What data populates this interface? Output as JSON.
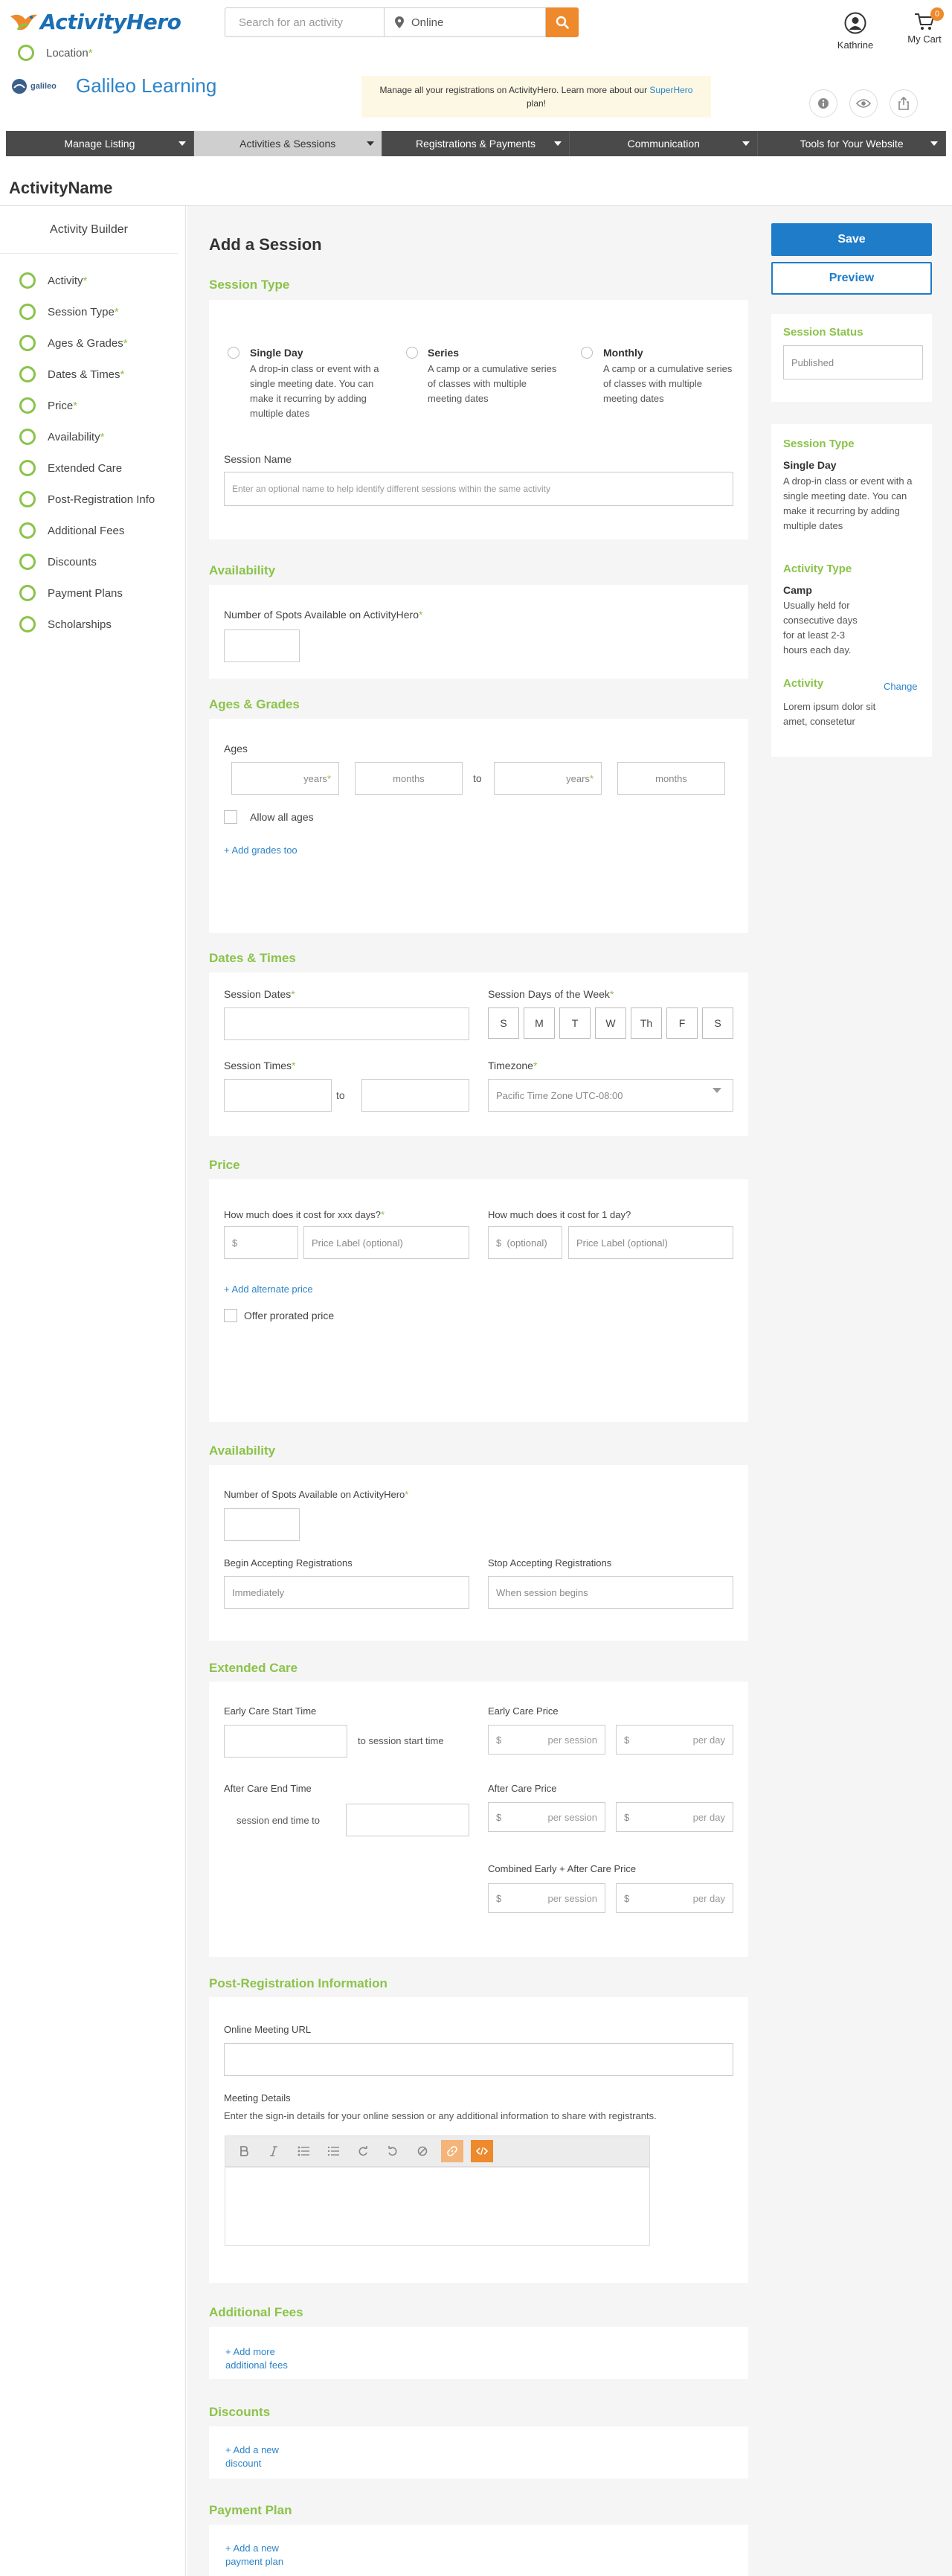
{
  "header": {
    "logo_text": "ActivityHero",
    "search_placeholder": "Search for an activity",
    "location_value": "Online",
    "user_name": "Kathrine",
    "cart_label": "My Cart",
    "cart_count": "0"
  },
  "location_step": {
    "label": "Location",
    "required": "*"
  },
  "organization": {
    "logo_text": "galileo",
    "name": "Galileo Learning"
  },
  "notice": {
    "text": "Manage all your registrations on ActivityHero. Learn more about our",
    "link": "SuperHero",
    "suffix": "plan!"
  },
  "nav": {
    "items": [
      {
        "label": "Manage Listing"
      },
      {
        "label": "Activities & Sessions"
      },
      {
        "label": "Registrations & Payments"
      },
      {
        "label": "Communication"
      },
      {
        "label": "Tools for Your Website"
      }
    ]
  },
  "page": {
    "title": "ActivityName"
  },
  "sidebar": {
    "title": "Activity Builder",
    "items": [
      {
        "label": "Activity",
        "required": "*"
      },
      {
        "label": "Session Type",
        "required": "*"
      },
      {
        "label": "Ages & Grades",
        "required": "*"
      },
      {
        "label": "Dates & Times",
        "required": "*"
      },
      {
        "label": "Price",
        "required": "*"
      },
      {
        "label": "Availability",
        "required": "*"
      },
      {
        "label": "Extended Care",
        "required": ""
      },
      {
        "label": "Post-Registration Info",
        "required": ""
      },
      {
        "label": "Additional Fees",
        "required": ""
      },
      {
        "label": "Discounts",
        "required": ""
      },
      {
        "label": "Payment Plans",
        "required": ""
      },
      {
        "label": "Scholarships",
        "required": ""
      }
    ]
  },
  "form": {
    "title": "Add a Session",
    "session_type": {
      "heading": "Session Type",
      "options": [
        {
          "title": "Single Day",
          "desc": "A drop-in class or event with a single meeting date. You can make it recurring by adding multiple dates"
        },
        {
          "title": "Series",
          "desc": "A camp or a cumulative series of classes with multiple meeting dates"
        },
        {
          "title": "Monthly",
          "desc": "A camp or a cumulative series of classes with multiple meeting dates"
        }
      ],
      "name_label": "Session Name",
      "name_placeholder": "Enter an optional name to help identify different sessions within the same activity"
    },
    "availability1": {
      "heading": "Availability",
      "spots_label": "Number of Spots Available on ActivityHero",
      "required": "*"
    },
    "ages": {
      "heading": "Ages & Grades",
      "label": "Ages",
      "years": "years",
      "months": "months",
      "to": "to",
      "allow_all": "Allow all ages",
      "add_grades": "+ Add grades too"
    },
    "dates": {
      "heading": "Dates & Times",
      "dates_label": "Session Dates",
      "days_label": "Session Days of the Week",
      "days": [
        "S",
        "M",
        "T",
        "W",
        "Th",
        "F",
        "S"
      ],
      "times_label": "Session Times",
      "to": "to",
      "tz_label": "Timezone",
      "tz_value": "Pacific Time Zone UTC-08:00",
      "required": "*"
    },
    "price": {
      "heading": "Price",
      "q1": "How much does it cost for xxx days?",
      "q2": "How much does it cost for 1 day?",
      "dollar": "$",
      "dollar_optional": "$  (optional)",
      "price_label_placeholder": "Price Label (optional)",
      "add_alternate": "+ Add alternate price",
      "prorated": "Offer prorated price",
      "required": "*"
    },
    "availability2": {
      "heading": "Availability",
      "spots_label": "Number of Spots Available on ActivityHero",
      "begin_label": "Begin Accepting Registrations",
      "begin_value": "Immediately",
      "stop_label": "Stop Accepting Registrations",
      "stop_value": "When session begins",
      "required": "*"
    },
    "extended": {
      "heading": "Extended Care",
      "early_start": "Early Care Start Time",
      "to_session_start": "to session start time",
      "early_price": "Early Care Price",
      "after_end": "After Care End Time",
      "session_end_to": "session end time to",
      "after_price": "After Care Price",
      "combined_price": "Combined Early + After Care Price",
      "dollar": "$",
      "per_session": "per session",
      "per_day": "per day"
    },
    "post_reg": {
      "heading": "Post-Registration Information",
      "url_label": "Online Meeting URL",
      "details_label": "Meeting Details",
      "details_help": "Enter the sign-in details for your online session or any additional information to share with registrants."
    },
    "fees": {
      "heading": "Additional Fees",
      "add_line1": "+ Add more",
      "add_line2": "additional fees"
    },
    "discounts": {
      "heading": "Discounts",
      "add_line1": "+ Add a new",
      "add_line2": "discount"
    },
    "payment_plan": {
      "heading": "Payment Plan",
      "add_line1": "+ Add a new",
      "add_line2": "payment plan"
    }
  },
  "right_panel": {
    "save": "Save",
    "preview": "Preview",
    "status_heading": "Session Status",
    "status_value": "Published",
    "type_heading": "Session Type",
    "type_value": "Single Day",
    "type_desc": "A drop-in class or event with a single meeting date. You can make it recurring by adding multiple dates",
    "activity_type_heading": "Activity Type",
    "activity_type_value": "Camp",
    "activity_type_desc": "Usually held for consecutive days for at least 2-3 hours each day.",
    "activity_heading": "Activity",
    "change": "Change",
    "activity_desc": "Lorem ipsum dolor sit amet, consetetur"
  },
  "colors": {
    "accent_green": "#8bc34a",
    "primary_blue": "#1f7cc9",
    "orange": "#ee8a2c",
    "nav_dark": "#4a4a4a"
  }
}
